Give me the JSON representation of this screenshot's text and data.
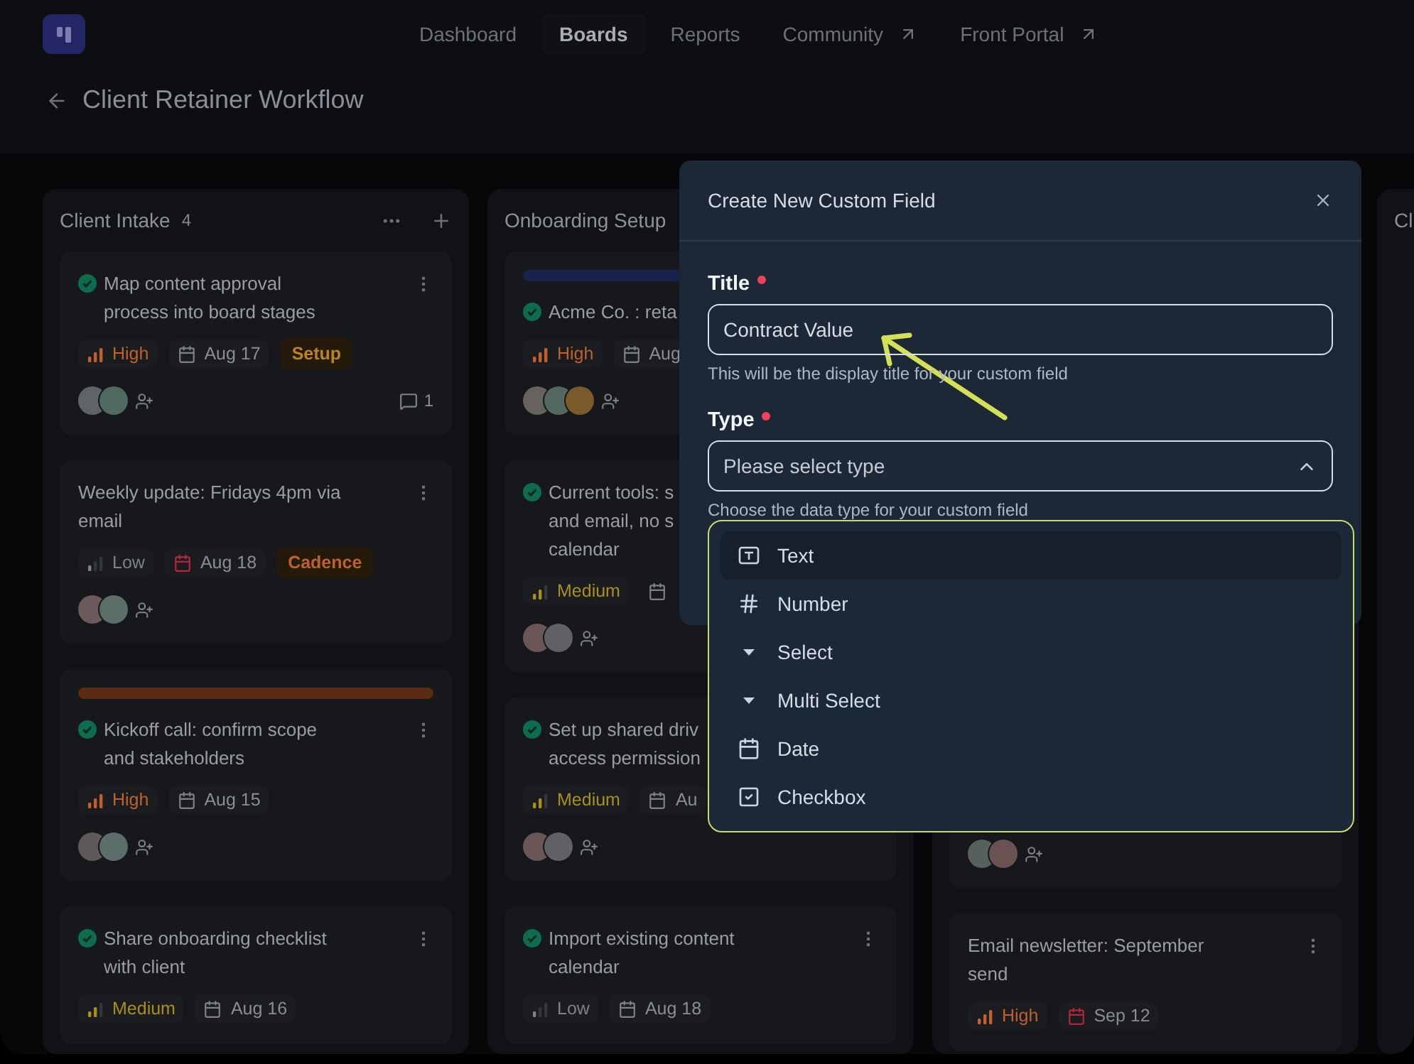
{
  "nav": {
    "items": [
      {
        "label": "Dashboard",
        "selected": false
      },
      {
        "label": "Boards",
        "selected": true
      },
      {
        "label": "Reports",
        "selected": false
      },
      {
        "label": "Community",
        "selected": false,
        "external": true
      },
      {
        "label": "Front Portal",
        "selected": false,
        "external": true
      }
    ]
  },
  "page": {
    "title": "Client Retainer Workflow"
  },
  "board": {
    "columns": [
      {
        "title": "Client Intake",
        "count": "4",
        "actions": true,
        "cards": [
          {
            "done": true,
            "title_lines": [
              "Map content approval",
              "process into board stages"
            ],
            "menu": true,
            "priority": {
              "label": "High",
              "kind": "high"
            },
            "date": {
              "text": "Aug 17",
              "overdue": false
            },
            "tag": {
              "label": "Setup",
              "color": "#b8861c"
            },
            "avatars": [
              {
                "color": "#5f6468"
              },
              {
                "color": "#4f6a60"
              }
            ],
            "add_assignee": true,
            "comments": "1"
          },
          {
            "title_lines": [
              "Weekly update: Fridays 4pm via",
              "email"
            ],
            "menu": true,
            "priority": {
              "label": "Low",
              "kind": "low"
            },
            "date": {
              "text": "Aug 18",
              "overdue": true
            },
            "tag": {
              "label": "Cadence",
              "color": "#c0602a"
            },
            "avatars": [
              {
                "color": "#6a5a5c"
              },
              {
                "color": "#5c6e68"
              }
            ],
            "add_assignee": true
          },
          {
            "done": true,
            "cover": {
              "color": "#5a2a12"
            },
            "title_lines": [
              "Kickoff call: confirm scope",
              "and stakeholders"
            ],
            "menu": true,
            "priority": {
              "label": "High",
              "kind": "high"
            },
            "date": {
              "text": "Aug 15",
              "overdue": false
            },
            "avatars": [
              {
                "color": "#5e5a5a"
              },
              {
                "color": "#5a6e6a"
              }
            ],
            "add_assignee": true
          },
          {
            "done": true,
            "title_lines": [
              "Share onboarding checklist",
              "with client"
            ],
            "menu": true,
            "priority": {
              "label": "Medium",
              "kind": "medium"
            },
            "date": {
              "text": "Aug 16",
              "overdue": false
            }
          }
        ]
      },
      {
        "title": "Onboarding Setup",
        "cards": [
          {
            "done": true,
            "cover": {
              "color": "#18224a"
            },
            "title_lines": [
              "Acme Co. : reta"
            ],
            "priority": {
              "label": "High",
              "kind": "high"
            },
            "date": {
              "text": "Aug",
              "overdue": false
            },
            "avatars": [
              {
                "color": "#66625e"
              },
              {
                "color": "#55685f"
              },
              {
                "color": "#7a5a2a"
              }
            ],
            "add_assignee": true
          },
          {
            "done": true,
            "title_lines": [
              "Current tools: s",
              "and email, no s",
              "calendar"
            ],
            "priority": {
              "label": "Medium",
              "kind": "medium"
            },
            "date": {
              "overdue": false
            },
            "avatars": [
              {
                "color": "#6a5656"
              },
              {
                "color": "#606166"
              }
            ],
            "add_assignee": true
          },
          {
            "done": true,
            "title_lines": [
              "Set up shared driv",
              "access permission"
            ],
            "priority": {
              "label": "Medium",
              "kind": "medium"
            },
            "date": {
              "text": "Au",
              "overdue": false
            },
            "avatars": [
              {
                "color": "#6a5656"
              },
              {
                "color": "#606166"
              }
            ],
            "add_assignee": true
          },
          {
            "done": true,
            "title_lines": [
              "Import existing content",
              "calendar"
            ],
            "menu": true,
            "priority": {
              "label": "Low",
              "kind": "low"
            },
            "date": {
              "text": "Aug 18",
              "overdue": false
            }
          }
        ]
      },
      {
        "cards": [
          {
            "avatars": [
              {
                "color": "#56605c"
              },
              {
                "color": "#6a5252"
              }
            ],
            "add_assignee": true
          },
          {
            "title_lines": [
              "Email newsletter: September",
              "send"
            ],
            "menu": true,
            "priority": {
              "label": "High",
              "kind": "high"
            },
            "date": {
              "text": "Sep 12",
              "overdue": true
            }
          }
        ]
      },
      {
        "title": "Cl"
      }
    ]
  },
  "dialog": {
    "title": "Create New Custom Field",
    "fields": [
      {
        "kind": "input",
        "label": "Title",
        "required": true,
        "value": "Contract Value",
        "helper": "This will be the display title for your custom field"
      },
      {
        "kind": "select",
        "label": "Type",
        "required": true,
        "placeholder": "Please select type",
        "expanded": true,
        "helper": "Choose the data type for your custom field"
      }
    ],
    "options": [
      {
        "label": "Text",
        "kind": "text",
        "highlighted": true
      },
      {
        "label": "Number",
        "kind": "number",
        "highlighted": false
      },
      {
        "label": "Select",
        "kind": "select",
        "highlighted": false
      },
      {
        "label": "Multi Select",
        "kind": "multi_select",
        "highlighted": false
      },
      {
        "label": "Date",
        "kind": "date",
        "highlighted": false
      },
      {
        "label": "Checkbox",
        "kind": "checkbox",
        "highlighted": false
      }
    ]
  }
}
